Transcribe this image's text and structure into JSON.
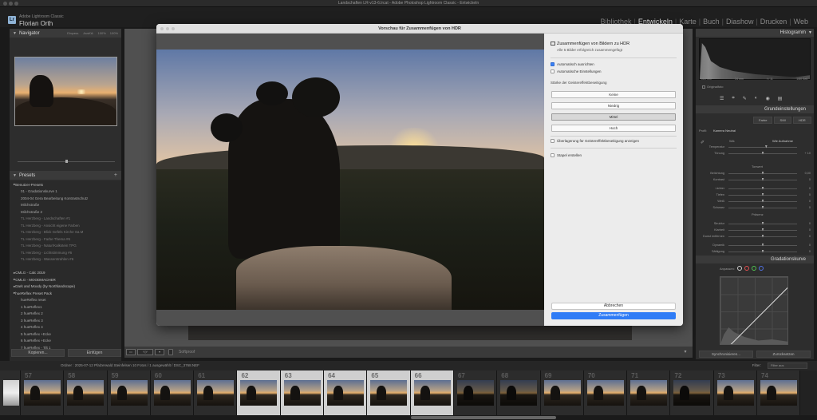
{
  "window": {
    "title": "Landschaften LR-v13-6.lrcat - Adobe Photoshop Lightroom Classic - Entwickeln"
  },
  "identity": {
    "app_name": "Adobe Lightroom Classic",
    "user": "Florian Orth",
    "logo_text": "Lr"
  },
  "modules": [
    "Bibliothek",
    "Entwickeln",
    "Karte",
    "Buch",
    "Diashow",
    "Drucken",
    "Web"
  ],
  "active_module": "Entwickeln",
  "left_panel": {
    "navigator_title": "Navigator",
    "navigator_zoom": [
      "Einpass.",
      "Ausfüll.",
      "100%",
      "100%"
    ],
    "presets_title": "Presets",
    "preset_items": [
      {
        "label": "Benutzer-Presets",
        "type": "group"
      },
      {
        "label": "01 - Gradationskurve 1",
        "type": "item"
      },
      {
        "label": "2004-04 Gera Bearbeitung Kontrastschutz",
        "type": "item"
      },
      {
        "label": "Milchstraße",
        "type": "item"
      },
      {
        "label": "Milchstraße 2",
        "type": "item"
      },
      {
        "label": "TL Herzberg - Landschaften #1",
        "type": "dim"
      },
      {
        "label": "TL Herzberg - Ansicht eigene Farben",
        "type": "dim"
      },
      {
        "label": "TL Herzberg - Blick Gefels Kirche Sa.M",
        "type": "dim"
      },
      {
        "label": "TL Herzberg - Farbe Thema #6",
        "type": "dim"
      },
      {
        "label": "TL Herzberg - Natur/Kalkstein TPG",
        "type": "dim"
      },
      {
        "label": "TL Herzberg - Lichtstimmung #6",
        "type": "dim"
      },
      {
        "label": "TL Herzberg - Wasserstrahlen #6",
        "type": "dim"
      },
      {
        "label": "",
        "type": "spacer"
      },
      {
        "label": "CMLG - Calc 2019",
        "type": "group"
      },
      {
        "label": "CMLG - MOODMACHER",
        "type": "group"
      },
      {
        "label": "Dark and Moody (by Northlandscape)",
        "type": "group"
      },
      {
        "label": "hueReflex Preset Pack",
        "type": "group"
      },
      {
        "label": "hueReflex reset",
        "type": "item"
      },
      {
        "label": "1 hueReflex1",
        "type": "item"
      },
      {
        "label": "2 hueReflex 2",
        "type": "item"
      },
      {
        "label": "3 hueReflex 3",
        "type": "item"
      },
      {
        "label": "4 hueReflex 4",
        "type": "item"
      },
      {
        "label": "5 hueReflex +Ecke",
        "type": "item"
      },
      {
        "label": "6 hueReflex +Ecke",
        "type": "item"
      },
      {
        "label": "7 hueReflex - Tilt 1",
        "type": "item"
      }
    ],
    "copy_button": "Kopieren...",
    "paste_button": "Einfügen"
  },
  "center": {
    "toolbar": {
      "softproof": "Softproof"
    }
  },
  "dialog": {
    "title": "Vorschau für Zusammenfügen von HDR",
    "header": "Zusammenfügen von Bildern zu HDR",
    "subheader": "Alle 5 Bilder erfolgreich zusammengefügt",
    "checkbox_auto_align": "Automatisch ausrichten",
    "checkbox_auto_align_checked": true,
    "checkbox_auto_settings": "Automatische Einstellungen",
    "checkbox_auto_settings_checked": false,
    "deghost_label": "Stärke der Geistereffektbeseitigung",
    "deghost_options": [
      "Keine",
      "Niedrig",
      "Mittel",
      "Hoch"
    ],
    "deghost_selected": "Mittel",
    "checkbox_overlay": "Überlagerung für Geistereffektbeseitigung anzeigen",
    "checkbox_overlay_checked": false,
    "checkbox_stack": "Stapel erstellen",
    "checkbox_stack_checked": false,
    "cancel_button": "Abbrechen",
    "merge_button": "Zusammenfügen"
  },
  "right_panel": {
    "histogram_title": "Histogramm",
    "histogram_labels": [
      "ISO 100",
      "24 mm",
      "f / 11",
      "1/80 Sek."
    ],
    "original_photo": "Originalfoto",
    "basic_title": "Grundeinstellungen",
    "treatment_buttons": [
      "Farbe",
      "S/W",
      "HDR"
    ],
    "profile_label": "Profil:",
    "profile_value": "Kamera Neutral",
    "wb_label": "WA:",
    "wb_value": "Wie Aufnahme",
    "sliders": [
      {
        "name": "Temperatur",
        "value": "",
        "pos": 0.55
      },
      {
        "name": "Tönung",
        "value": "+ 10",
        "pos": 0.5
      },
      {
        "name": "Belichtung",
        "value": "0,00",
        "pos": 0.5
      },
      {
        "name": "Kontrast",
        "value": "0",
        "pos": 0.5
      },
      {
        "name": "Lichter",
        "value": "0",
        "pos": 0.5
      },
      {
        "name": "Tiefen",
        "value": "0",
        "pos": 0.5
      },
      {
        "name": "Weiß",
        "value": "0",
        "pos": 0.5
      },
      {
        "name": "Schwarz",
        "value": "0",
        "pos": 0.5
      },
      {
        "name": "Struktur",
        "value": "0",
        "pos": 0.5
      },
      {
        "name": "Klarheit",
        "value": "0",
        "pos": 0.5
      },
      {
        "name": "Dunst entfernen",
        "value": "0",
        "pos": 0.5
      },
      {
        "name": "Dynamik",
        "value": "0",
        "pos": 0.5
      },
      {
        "name": "Sättigung",
        "value": "0",
        "pos": 0.5
      }
    ],
    "tone_label": "Tonwert",
    "presence_label": "Präsenz",
    "tone_curve_title": "Gradationskurve",
    "channel_label": "Anpassen:",
    "sync_button": "Synchronisieren...",
    "reset_button": "Zurücksetzen"
  },
  "filmbar": {
    "info": "Ordner : 2025-07-12 Pfalzerwald Steinfelsen   10 Fotos / 1 ausgewählt / DSC_3768.NEF",
    "filter_label": "Filter:",
    "filter_value": "Filter aus"
  },
  "filmstrip": [
    {
      "num": "",
      "state": "partial"
    },
    {
      "num": "57",
      "state": "normal"
    },
    {
      "num": "58",
      "state": "normal"
    },
    {
      "num": "59",
      "state": "normal"
    },
    {
      "num": "60",
      "state": "normal"
    },
    {
      "num": "61",
      "state": "normal"
    },
    {
      "num": "62",
      "state": "selected"
    },
    {
      "num": "63",
      "state": "selected"
    },
    {
      "num": "64",
      "state": "selected"
    },
    {
      "num": "65",
      "state": "selected"
    },
    {
      "num": "66",
      "state": "selected"
    },
    {
      "num": "67",
      "state": "dark"
    },
    {
      "num": "68",
      "state": "dark"
    },
    {
      "num": "69",
      "state": "normal"
    },
    {
      "num": "70",
      "state": "normal"
    },
    {
      "num": "71",
      "state": "normal"
    },
    {
      "num": "72",
      "state": "dark"
    },
    {
      "num": "73",
      "state": "normal"
    },
    {
      "num": "74",
      "state": "normal"
    }
  ]
}
